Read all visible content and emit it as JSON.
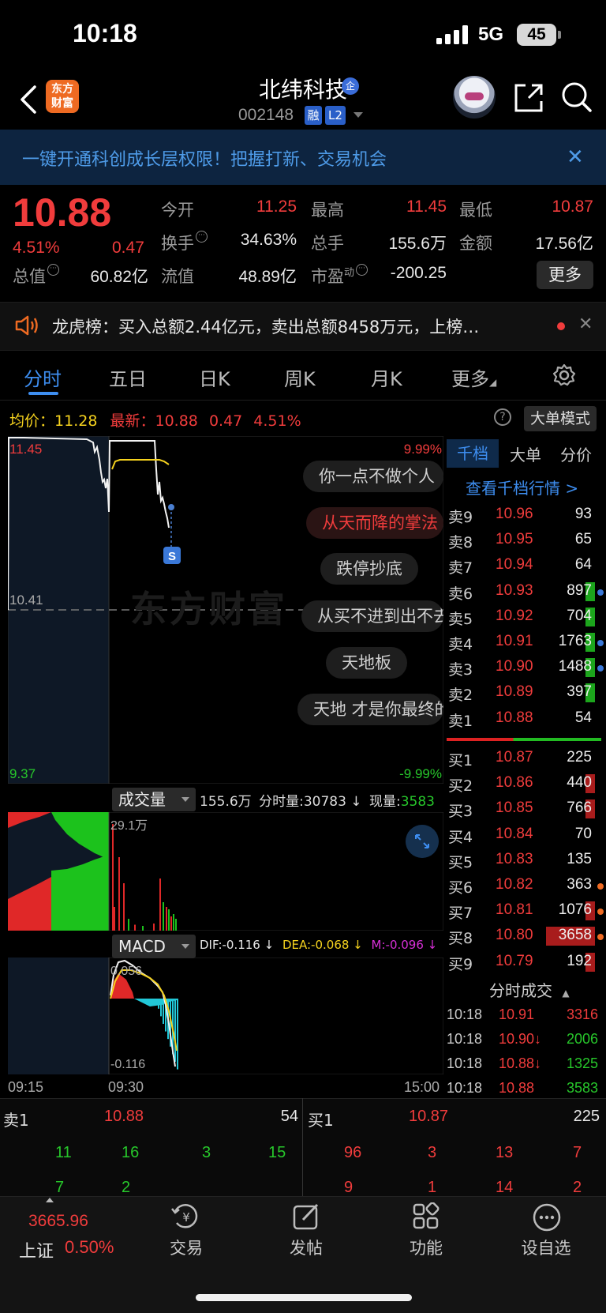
{
  "status_bar": {
    "time": "10:18",
    "network": "5G",
    "battery": "45"
  },
  "nav": {
    "logo_line1": "东方",
    "logo_line2": "财富",
    "stock_name": "北纬科技",
    "badge": "企",
    "code": "002148",
    "tag_rong": "融",
    "tag_l2": "L2"
  },
  "banner": {
    "text": "一键开通科创成长层权限！把握打新、交易机会",
    "close": "✕"
  },
  "quote": {
    "price": "10.88",
    "change_pct": "4.51%",
    "change": "0.47",
    "open_label": "今开",
    "open": "11.25",
    "high_label": "最高",
    "high": "11.45",
    "low_label": "最低",
    "low": "10.87",
    "turnover_label": "换手",
    "turnover": "34.63%",
    "volume_label": "总手",
    "volume": "155.6万",
    "amount_label": "金额",
    "amount": "17.56亿",
    "mcap_label": "总值",
    "mcap": "60.82亿",
    "float_label": "流值",
    "float": "48.89亿",
    "pe_label": "市盈",
    "pe_sup": "动",
    "pe": "-200.25",
    "more": "更多"
  },
  "lhb": {
    "text": "龙虎榜：买入总额2.44亿元，卖出总额8458万元，上榜…",
    "close": "✕"
  },
  "tabs": [
    "分时",
    "五日",
    "日K",
    "周K",
    "月K",
    "更多"
  ],
  "chart_head": {
    "avg_label": "均价：",
    "avg": "11.28",
    "last_label": "最新：",
    "last": "10.88",
    "chg": "0.47",
    "pct": "4.51%",
    "help": "?",
    "big_order_btn": "大单模式"
  },
  "price_chart": {
    "top_price": "11.45",
    "mid_price": "10.41",
    "bottom_price": "9.37",
    "top_pct": "9.99%",
    "bottom_pct": "-9.99%",
    "watermark": "东方财富",
    "signal": "S"
  },
  "bubbles": [
    "你一点不做个人",
    "从天而降的掌法",
    "跌停抄底",
    "从买不进到出不去",
    "天地板",
    "天地 才是你最终的"
  ],
  "volume": {
    "btn": "成交量",
    "total": "155.6万",
    "fen_label": "分时量:",
    "fen": "30783 ↓",
    "now_label": "现量:",
    "now": "3583",
    "max_label": "29.1万"
  },
  "macd": {
    "btn": "MACD",
    "dif": "DIF:-0.116 ↓",
    "dea": "DEA:-0.068 ↓",
    "m": "M:-0.096 ↓",
    "top": "0.056",
    "bottom": "-0.116"
  },
  "time_axis": {
    "start": "09:15",
    "open": "09:30",
    "end": "15:00"
  },
  "orderbook": {
    "tabs": [
      "千档",
      "大单",
      "分价"
    ],
    "link": "查看千档行情 >",
    "asks": [
      {
        "label": "卖9",
        "price": "10.96",
        "vol": "93"
      },
      {
        "label": "卖8",
        "price": "10.95",
        "vol": "65"
      },
      {
        "label": "卖7",
        "price": "10.94",
        "vol": "64"
      },
      {
        "label": "卖6",
        "price": "10.93",
        "vol": "897"
      },
      {
        "label": "卖5",
        "price": "10.92",
        "vol": "704"
      },
      {
        "label": "卖4",
        "price": "10.91",
        "vol": "1763"
      },
      {
        "label": "卖3",
        "price": "10.90",
        "vol": "1488"
      },
      {
        "label": "卖2",
        "price": "10.89",
        "vol": "397"
      },
      {
        "label": "卖1",
        "price": "10.88",
        "vol": "54"
      }
    ],
    "bids": [
      {
        "label": "买1",
        "price": "10.87",
        "vol": "225"
      },
      {
        "label": "买2",
        "price": "10.86",
        "vol": "440"
      },
      {
        "label": "买3",
        "price": "10.85",
        "vol": "766"
      },
      {
        "label": "买4",
        "price": "10.84",
        "vol": "70"
      },
      {
        "label": "买5",
        "price": "10.83",
        "vol": "135"
      },
      {
        "label": "买6",
        "price": "10.82",
        "vol": "363"
      },
      {
        "label": "买7",
        "price": "10.81",
        "vol": "1076"
      },
      {
        "label": "买8",
        "price": "10.80",
        "vol": "3658"
      },
      {
        "label": "买9",
        "price": "10.79",
        "vol": "192"
      }
    ],
    "trades_head": "分时成交",
    "trades": [
      {
        "time": "10:18",
        "price": "10.91",
        "vol": "3316"
      },
      {
        "time": "10:18",
        "price": "10.90↓",
        "vol": "2006"
      },
      {
        "time": "10:18",
        "price": "10.88↓",
        "vol": "1325"
      },
      {
        "time": "10:18",
        "price": "10.88",
        "vol": "3583"
      }
    ]
  },
  "strip": {
    "ask_label": "卖1",
    "ask_price": "10.88",
    "ask_vol": "54",
    "bid_label": "买1",
    "bid_price": "10.87",
    "bid_vol": "225",
    "left_row1": [
      "11",
      "16",
      "3",
      "15"
    ],
    "left_row2": [
      "7",
      "2"
    ],
    "right_row1": [
      "96",
      "3",
      "13",
      "7"
    ],
    "right_row2": [
      "9",
      "1",
      "14",
      "2"
    ]
  },
  "bottom_nav": {
    "index_value": "3665.96",
    "index_name": "上证",
    "index_pct": "0.50%",
    "items": [
      "交易",
      "发帖",
      "功能",
      "设自选"
    ]
  },
  "colors": {
    "up": "#f03c3c",
    "down": "#27c72b",
    "accent": "#3e8ef0",
    "avg_line": "#f5d21e"
  }
}
